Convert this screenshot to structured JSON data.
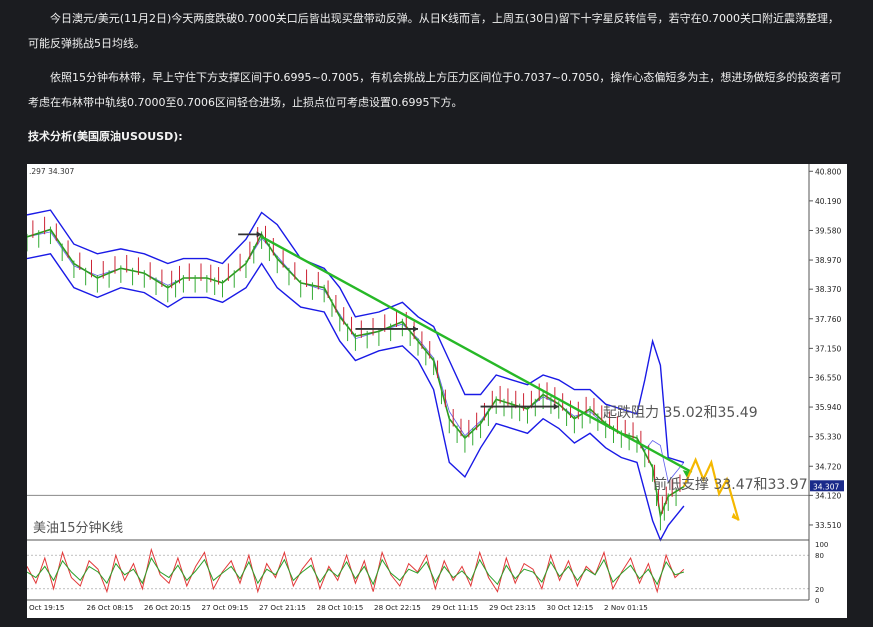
{
  "article": {
    "para1": "今日澳元/美元(11月2日)今天两度跌破0.7000关口后皆出现买盘带动反弹。从日K线而言，上周五(30日)留下十字星反转信号，若守在0.7000关口附近震荡整理，可能反弹挑战5日均线。",
    "para2": "依照15分钟布林带，早上守住下方支撑区间于0.6995~0.7005，有机会挑战上方压力区间位于0.7037~0.7050，操作心态偏短多为主，想进场做短多的投资者可考虑在布林带中轨线0.7000至0.7006区间轻仓进场，止损点位可考虑设置0.6995下方。",
    "heading": "技术分析(美国原油USOUSD):"
  },
  "chart": {
    "top_readout": ".297 34.307",
    "series_label": "美油15分钟K线",
    "annotation_resistance": "起跌阻力 35.02和35.49",
    "annotation_support": "前低支撑 33.47和33.97",
    "current_price": "34.307",
    "colors": {
      "band": "#1a1ae6",
      "price": "#2d9a1e",
      "trend": "#27b827",
      "projection": "#f5b800",
      "osc_red": "#e23a3a",
      "osc_green": "#2aa02a"
    }
  },
  "chart_data": {
    "type": "line",
    "title": "",
    "xlabel": "",
    "ylabel": "",
    "ylim": [
      33.2,
      40.95
    ],
    "y_ticks": [
      "40.800",
      "40.190",
      "39.580",
      "38.970",
      "38.370",
      "37.760",
      "37.150",
      "36.550",
      "35.940",
      "35.330",
      "34.720",
      "34.120",
      "33.510"
    ],
    "y_tick_values": [
      40.8,
      40.19,
      39.58,
      38.97,
      38.37,
      37.76,
      37.15,
      36.55,
      35.94,
      35.33,
      34.72,
      34.12,
      33.51
    ],
    "x_ticks": [
      "Oct 19:15",
      "26 Oct 08:15",
      "26 Oct 20:15",
      "27 Oct 09:15",
      "27 Oct 21:15",
      "28 Oct 10:15",
      "28 Oct 22:15",
      "29 Oct 11:15",
      "29 Oct 23:15",
      "30 Oct 12:15",
      "2 Nov 01:15"
    ],
    "osc_ticks": [
      "100",
      "80",
      "20",
      "0"
    ],
    "osc_tick_values": [
      100,
      80,
      20,
      0
    ],
    "price_path": [
      [
        0,
        39.45
      ],
      [
        3,
        39.6
      ],
      [
        6,
        38.9
      ],
      [
        9,
        38.6
      ],
      [
        12,
        38.8
      ],
      [
        15,
        38.7
      ],
      [
        18,
        38.4
      ],
      [
        20,
        38.6
      ],
      [
        23,
        38.6
      ],
      [
        25,
        38.5
      ],
      [
        28,
        38.9
      ],
      [
        30,
        39.5
      ],
      [
        32,
        39.0
      ],
      [
        35,
        38.5
      ],
      [
        38,
        38.4
      ],
      [
        40,
        37.8
      ],
      [
        42,
        37.4
      ],
      [
        45,
        37.5
      ],
      [
        48,
        37.7
      ],
      [
        50,
        37.3
      ],
      [
        52,
        36.9
      ],
      [
        54,
        35.7
      ],
      [
        56,
        35.3
      ],
      [
        58,
        35.6
      ],
      [
        60,
        36.1
      ],
      [
        62,
        36.0
      ],
      [
        64,
        35.9
      ],
      [
        66,
        36.2
      ],
      [
        68,
        36.0
      ],
      [
        70,
        35.7
      ],
      [
        72,
        35.9
      ],
      [
        74,
        35.6
      ],
      [
        76,
        35.4
      ],
      [
        78,
        35.3
      ],
      [
        80,
        34.7
      ],
      [
        81,
        33.7
      ],
      [
        82,
        34.1
      ],
      [
        84,
        34.3
      ]
    ],
    "upper_band": [
      [
        0,
        39.9
      ],
      [
        3,
        40.0
      ],
      [
        6,
        39.3
      ],
      [
        9,
        39.1
      ],
      [
        12,
        39.2
      ],
      [
        15,
        39.1
      ],
      [
        18,
        38.9
      ],
      [
        20,
        39.0
      ],
      [
        23,
        39.0
      ],
      [
        25,
        38.9
      ],
      [
        28,
        39.4
      ],
      [
        30,
        39.95
      ],
      [
        32,
        39.7
      ],
      [
        35,
        39.0
      ],
      [
        38,
        38.8
      ],
      [
        40,
        38.4
      ],
      [
        42,
        37.8
      ],
      [
        45,
        37.9
      ],
      [
        48,
        38.1
      ],
      [
        50,
        37.8
      ],
      [
        52,
        37.6
      ],
      [
        54,
        36.9
      ],
      [
        56,
        36.2
      ],
      [
        58,
        36.2
      ],
      [
        60,
        36.6
      ],
      [
        62,
        36.5
      ],
      [
        64,
        36.4
      ],
      [
        66,
        36.6
      ],
      [
        68,
        36.5
      ],
      [
        70,
        36.3
      ],
      [
        72,
        36.3
      ],
      [
        74,
        36.0
      ],
      [
        76,
        35.9
      ],
      [
        78,
        35.8
      ],
      [
        79,
        36.5
      ],
      [
        80,
        37.3
      ],
      [
        81,
        36.8
      ],
      [
        82,
        34.9
      ],
      [
        84,
        34.8
      ]
    ],
    "lower_band": [
      [
        0,
        39.0
      ],
      [
        3,
        39.1
      ],
      [
        6,
        38.4
      ],
      [
        9,
        38.2
      ],
      [
        12,
        38.4
      ],
      [
        15,
        38.3
      ],
      [
        18,
        38.0
      ],
      [
        20,
        38.2
      ],
      [
        23,
        38.2
      ],
      [
        25,
        38.1
      ],
      [
        28,
        38.4
      ],
      [
        30,
        38.9
      ],
      [
        32,
        38.4
      ],
      [
        35,
        38.0
      ],
      [
        38,
        37.9
      ],
      [
        40,
        37.3
      ],
      [
        42,
        36.9
      ],
      [
        45,
        37.1
      ],
      [
        48,
        37.2
      ],
      [
        50,
        36.9
      ],
      [
        52,
        36.3
      ],
      [
        54,
        34.8
      ],
      [
        56,
        34.5
      ],
      [
        58,
        35.1
      ],
      [
        60,
        35.6
      ],
      [
        62,
        35.5
      ],
      [
        64,
        35.4
      ],
      [
        66,
        35.7
      ],
      [
        68,
        35.5
      ],
      [
        70,
        35.2
      ],
      [
        72,
        35.4
      ],
      [
        74,
        35.1
      ],
      [
        76,
        34.9
      ],
      [
        78,
        34.8
      ],
      [
        80,
        33.6
      ],
      [
        81,
        33.2
      ],
      [
        82,
        33.5
      ],
      [
        84,
        33.9
      ]
    ],
    "trendline": [
      [
        30,
        39.45
      ],
      [
        85,
        34.6
      ]
    ],
    "horizontal_marks": [
      [
        27,
        30,
        39.5
      ],
      [
        42,
        50,
        37.55
      ],
      [
        58,
        68,
        35.95
      ]
    ],
    "support_line": 34.12,
    "projection": [
      [
        84,
        34.3
      ],
      [
        85.5,
        34.85
      ],
      [
        86.5,
        34.45
      ],
      [
        87.5,
        34.8
      ],
      [
        88.5,
        34.15
      ],
      [
        89.5,
        34.45
      ],
      [
        91,
        33.6
      ]
    ],
    "osc_series": [
      {
        "name": "",
        "values": [
          60,
          30,
          75,
          20,
          85,
          40,
          25,
          70,
          55,
          15,
          80,
          35,
          65,
          20,
          90,
          45,
          30,
          75,
          25,
          60,
          85,
          20,
          50,
          70,
          30,
          80,
          15,
          65,
          40,
          85,
          25,
          55,
          75,
          20,
          60,
          35,
          80,
          30,
          70,
          15,
          85,
          45,
          25,
          65,
          50,
          80,
          20,
          70,
          35,
          60,
          25,
          85,
          40,
          15,
          75,
          30,
          65,
          55,
          20,
          80,
          35,
          70,
          25,
          60,
          45,
          85,
          20,
          50,
          75,
          30,
          65,
          15,
          80,
          40,
          55
        ]
      },
      {
        "name": "",
        "values": [
          50,
          40,
          60,
          35,
          70,
          50,
          35,
          60,
          50,
          30,
          65,
          45,
          55,
          30,
          75,
          50,
          40,
          62,
          35,
          52,
          72,
          35,
          48,
          60,
          38,
          68,
          30,
          55,
          45,
          72,
          35,
          50,
          62,
          32,
          55,
          42,
          68,
          38,
          60,
          28,
          72,
          48,
          35,
          55,
          48,
          68,
          32,
          60,
          40,
          52,
          35,
          72,
          45,
          28,
          62,
          38,
          55,
          50,
          32,
          68,
          42,
          60,
          35,
          55,
          45,
          72,
          32,
          48,
          62,
          38,
          55,
          28,
          68,
          45,
          50
        ]
      }
    ]
  }
}
